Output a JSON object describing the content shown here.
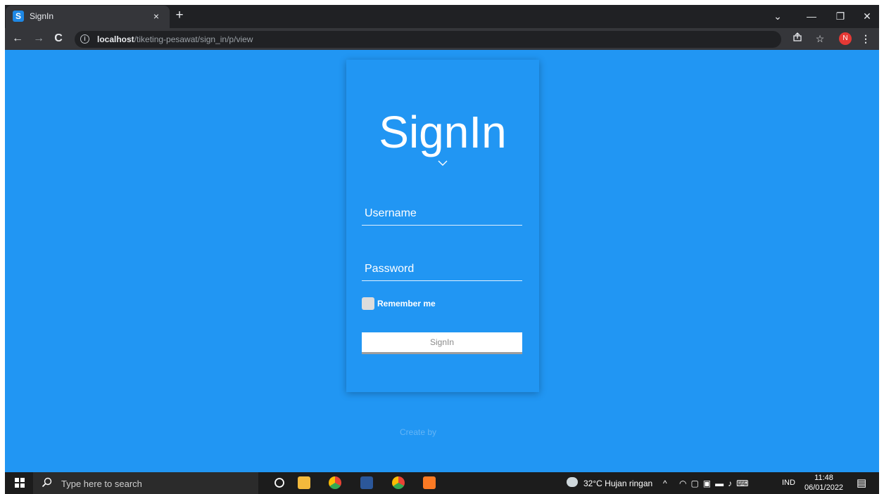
{
  "browser": {
    "tab_title": "SignIn",
    "tab_favicon": "S",
    "close_glyph": "×",
    "newtab_glyph": "+",
    "url_host": "localhost",
    "url_path": "/tiketing-pesawat/sign_in/p/view",
    "profile_initial": "N",
    "window_controls": [
      "⌄",
      "—",
      "❐",
      "✕"
    ],
    "nav": {
      "back": "←",
      "forward": "→",
      "reload": "C"
    }
  },
  "page": {
    "title": "SignIn",
    "username_placeholder": "Username",
    "password_placeholder": "Password",
    "remember_label": "Remember me",
    "signin_button": "SignIn",
    "footer": "Create by",
    "colors": {
      "background": "#2196f3",
      "text": "#ffffff"
    }
  },
  "taskbar": {
    "search_placeholder": "Type here to search",
    "weather": "32°C  Hujan ringan",
    "language": "IND",
    "time": "11:48",
    "date": "06/01/2022"
  }
}
